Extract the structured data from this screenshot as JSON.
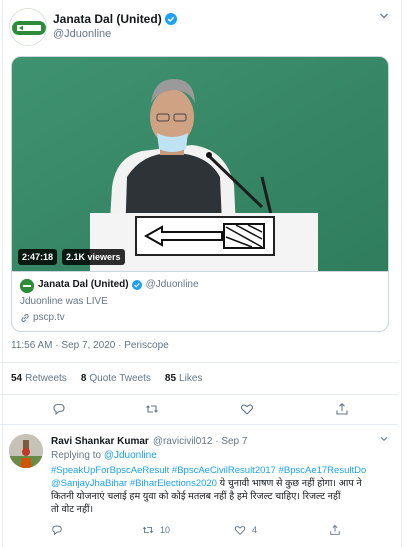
{
  "tweet": {
    "display_name": "Janata Dal (United)",
    "handle": "@Jduonline",
    "timestamp": "11:56 AM · Sep 7, 2020 · Periscope",
    "stats": {
      "retweets_count": "54",
      "retweets_label": "Retweets",
      "quotes_count": "8",
      "quotes_label": "Quote Tweets",
      "likes_count": "85",
      "likes_label": "Likes"
    },
    "card": {
      "duration": "2:47:18",
      "viewers": "2.1K viewers",
      "author_name": "Janata Dal (United)",
      "author_handle": "@Jduonline",
      "description": "Jduonline was LIVE",
      "link": "pscp.tv"
    }
  },
  "reply": {
    "display_name": "Ravi Shankar Kumar",
    "handle_date": "@ravicivil012 · Sep 7",
    "replying_prefix": "Replying to",
    "replying_to": "@Jduonline",
    "hashtags_line1": "#SpeakUpForBpscAeResult #BpscAeCivilResult2017 #BpscAe17ResultDo",
    "hashtags_line2": "@SanjayJhaBihar #BiharElections2020",
    "body_line2": " ये चुनावी भाषण से कुछ नहीं होगा। आप ने",
    "body_line3": "कितनी योजनाएं चलाई  हम युवा को कोई मतलब नहीं है हमे  रिजल्ट चाहिए। रिजल्ट नहीं",
    "body_line4": "तो वोट नहीं।",
    "retweet_count": "10",
    "like_count": "4"
  },
  "colors": {
    "accent": "#1da1f2",
    "secondary_text": "#657786",
    "border": "#e6ecf0",
    "party_green": "#2e8b3a"
  },
  "icons": [
    "jdu-logo-icon",
    "verified-badge-icon",
    "chevron-down-icon",
    "link-icon",
    "reply-icon",
    "retweet-icon",
    "like-icon",
    "share-icon"
  ]
}
